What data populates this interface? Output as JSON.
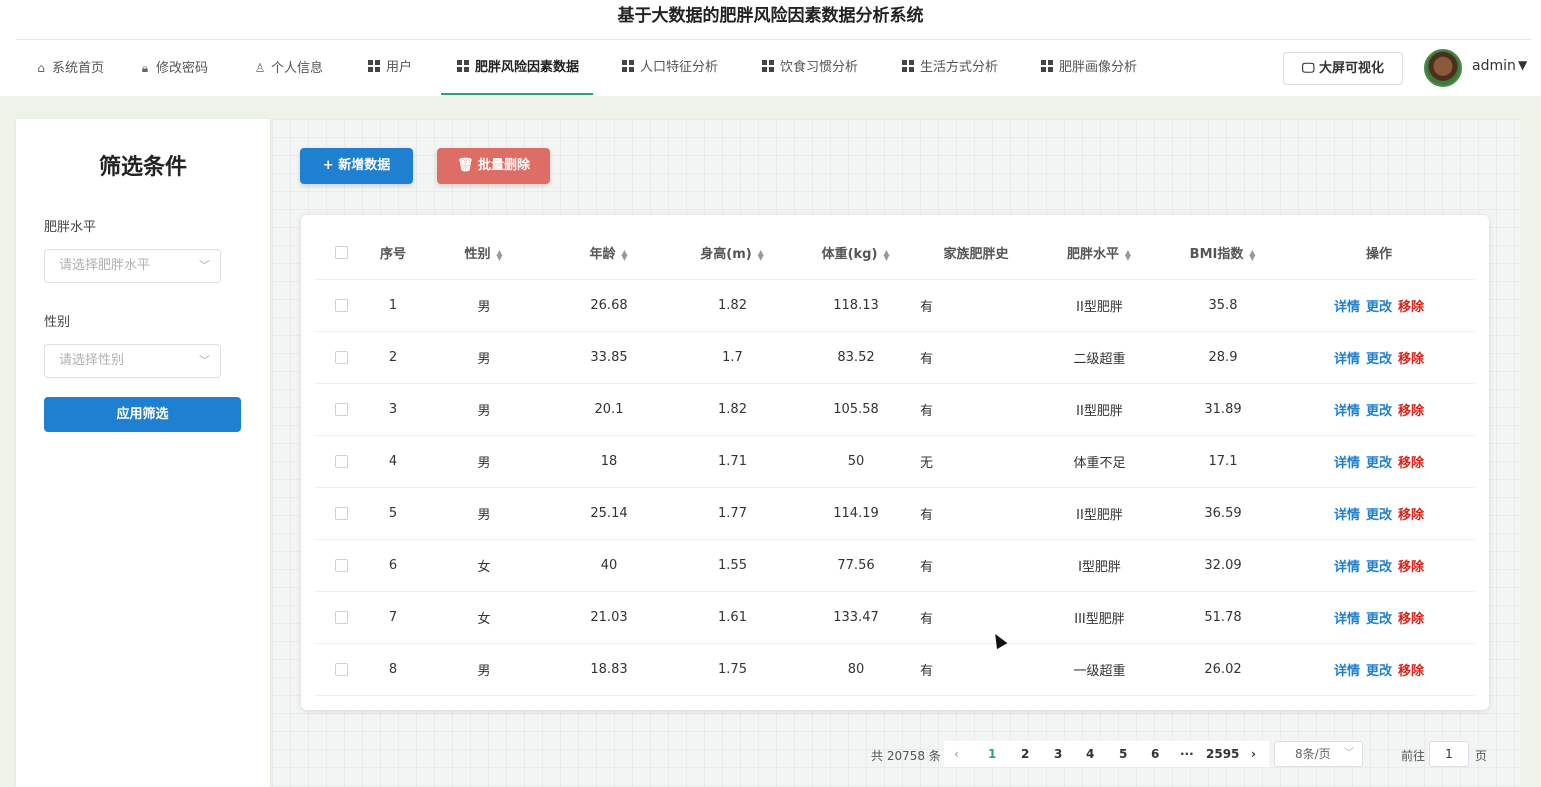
{
  "app_title": "基于大数据的肥胖风险因素数据分析系统",
  "nav": {
    "items": [
      {
        "label": "系统首页",
        "icon": "home-icon"
      },
      {
        "label": "修改密码",
        "icon": "lock-icon"
      },
      {
        "label": "个人信息",
        "icon": "user-icon"
      },
      {
        "label": "用户",
        "icon": "grid-icon"
      },
      {
        "label": "肥胖风险因素数据",
        "icon": "grid-icon"
      },
      {
        "label": "人口特征分析",
        "icon": "grid-icon"
      },
      {
        "label": "饮食习惯分析",
        "icon": "grid-icon"
      },
      {
        "label": "生活方式分析",
        "icon": "grid-icon"
      },
      {
        "label": "肥胖画像分析",
        "icon": "grid-icon"
      }
    ],
    "active_index": 4,
    "active_color": "#2aa37b",
    "bigscreen_label": "大屏可视化",
    "user_name": "admin"
  },
  "sidebar": {
    "title": "筛选条件",
    "filter1_label": "肥胖水平",
    "filter1_placeholder": "请选择肥胖水平",
    "filter2_label": "性别",
    "filter2_placeholder": "请选择性别",
    "apply_label": "应用筛选"
  },
  "toolbar": {
    "add_label": "+ 新增数据",
    "batch_delete_label": "批量删除"
  },
  "table": {
    "headers": [
      "序号",
      "性别",
      "年龄",
      "身高(m)",
      "体重(kg)",
      "家族肥胖史",
      "肥胖水平",
      "BMI指数",
      "操作"
    ],
    "rows": [
      [
        "1",
        "男",
        "26.68",
        "1.82",
        "118.13",
        "有",
        "II型肥胖",
        "35.8"
      ],
      [
        "2",
        "男",
        "33.85",
        "1.7",
        "83.52",
        "有",
        "二级超重",
        "28.9"
      ],
      [
        "3",
        "男",
        "20.1",
        "1.82",
        "105.58",
        "有",
        "II型肥胖",
        "31.89"
      ],
      [
        "4",
        "男",
        "18",
        "1.71",
        "50",
        "无",
        "体重不足",
        "17.1"
      ],
      [
        "5",
        "男",
        "25.14",
        "1.77",
        "114.19",
        "有",
        "II型肥胖",
        "36.59"
      ],
      [
        "6",
        "女",
        "40",
        "1.55",
        "77.56",
        "有",
        "I型肥胖",
        "32.09"
      ],
      [
        "7",
        "女",
        "21.03",
        "1.61",
        "133.47",
        "有",
        "III型肥胖",
        "51.78"
      ],
      [
        "8",
        "男",
        "18.83",
        "1.75",
        "80",
        "有",
        "一级超重",
        "26.02"
      ]
    ],
    "actions": {
      "detail": "详情",
      "edit": "更改",
      "remove": "移除"
    }
  },
  "pager": {
    "total_text": "共 20758 条",
    "pages": [
      "1",
      "2",
      "3",
      "4",
      "5",
      "6",
      "···",
      "2595"
    ],
    "current_page": "1",
    "page_size": "8条/页",
    "goto_label": "前往",
    "goto_value": "1",
    "page_word": "页"
  }
}
